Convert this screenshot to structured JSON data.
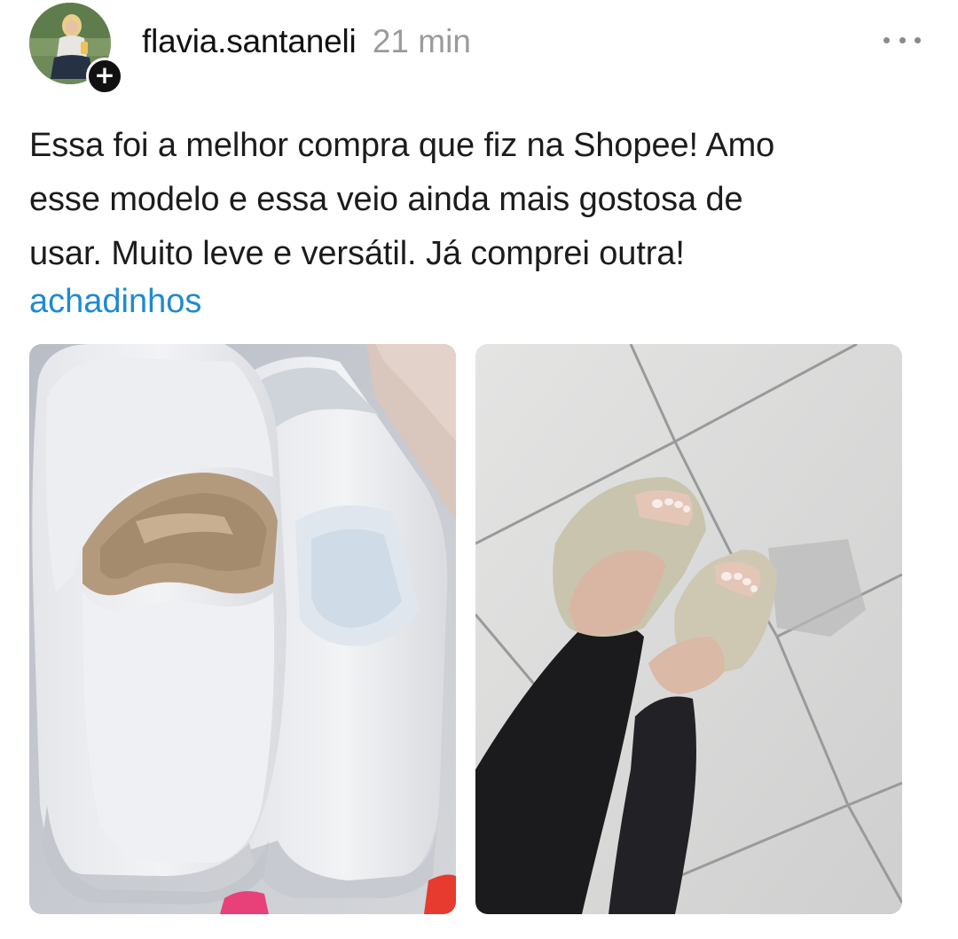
{
  "post": {
    "author": {
      "username": "flavia.santaneli",
      "time_ago": "21 min",
      "follow_badge": "+"
    },
    "caption_lines": [
      "Essa foi a melhor compra que fiz na Shopee! Amo",
      "esse modelo e essa veio ainda mais gostosa de",
      "usar. Muito leve e versátil. Já comprei outra!"
    ],
    "hashtag": "achadinhos",
    "icons": {
      "more": "more-horizontal-icon",
      "follow": "plus-icon"
    },
    "colors": {
      "link": "#1f8ad1",
      "timestamp": "#9b9b9b",
      "text": "#1c1c1c"
    }
  }
}
